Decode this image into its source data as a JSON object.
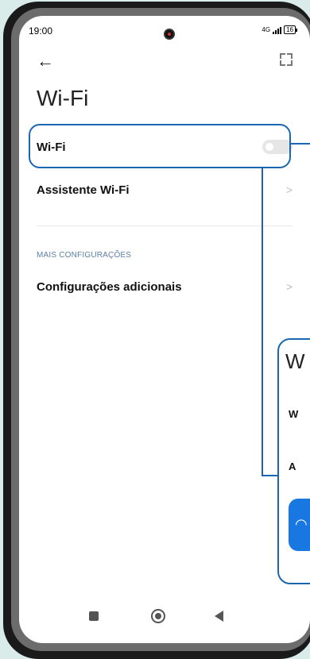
{
  "status_bar": {
    "time": "19:00",
    "network": "4G",
    "battery": "16"
  },
  "page": {
    "title": "Wi-Fi"
  },
  "rows": {
    "wifi": {
      "label": "Wi-Fi",
      "enabled": false
    },
    "assistant": {
      "label": "Assistente Wi-Fi"
    },
    "section_label": "MAIS CONFIGURAÇÕES",
    "additional": {
      "label": "Configurações adicionais"
    }
  },
  "callout": {
    "title": "W",
    "item1": "W",
    "item2": "A"
  },
  "colors": {
    "highlight": "#1b66b1",
    "section_label": "#5a7fa8",
    "callout_button": "#1877e0"
  },
  "icons": {
    "back": "back-arrow-icon",
    "scan": "qr-scan-icon",
    "chevron": "chevron-right-icon",
    "wifi": "wifi-icon"
  }
}
